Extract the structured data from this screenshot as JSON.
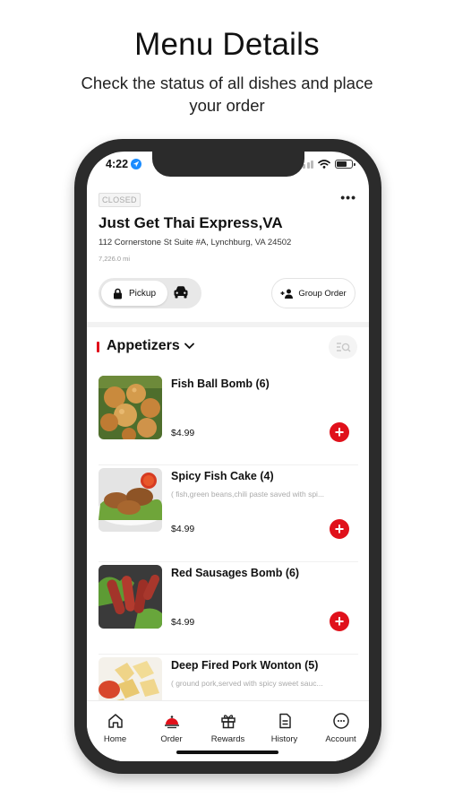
{
  "promo": {
    "title": "Menu Details",
    "subtitle": "Check the status of all dishes and place your order"
  },
  "status_bar": {
    "time": "4:22"
  },
  "restaurant": {
    "status": "CLOSED",
    "name": "Just Get Thai Express,VA",
    "address": "112 Cornerstone St Suite #A, Lynchburg, VA 24502",
    "distance": "7,226.0 mi"
  },
  "order_mode": {
    "pickup_label": "Pickup",
    "group_order_label": "Group Order"
  },
  "menu": {
    "category": "Appetizers",
    "items": [
      {
        "name": "Fish Ball Bomb (6)",
        "description": "",
        "price": "$4.99"
      },
      {
        "name": "Spicy Fish Cake (4)",
        "description": "( fish,green beans,chili paste saved with spi...",
        "price": "$4.99"
      },
      {
        "name": "Red Sausages Bomb (6)",
        "description": "",
        "price": "$4.99"
      },
      {
        "name": "Deep Fired Pork Wonton (5)",
        "description": "( ground pork,served with spicy sweet sauc...",
        "price": ""
      }
    ]
  },
  "tabs": [
    {
      "label": "Home",
      "icon": "home-icon"
    },
    {
      "label": "Order",
      "icon": "order-icon"
    },
    {
      "label": "Rewards",
      "icon": "gift-icon"
    },
    {
      "label": "History",
      "icon": "receipt-icon"
    },
    {
      "label": "Account",
      "icon": "account-icon"
    }
  ],
  "colors": {
    "accent": "#e0111b",
    "phone_frame": "#2b2b2b"
  }
}
